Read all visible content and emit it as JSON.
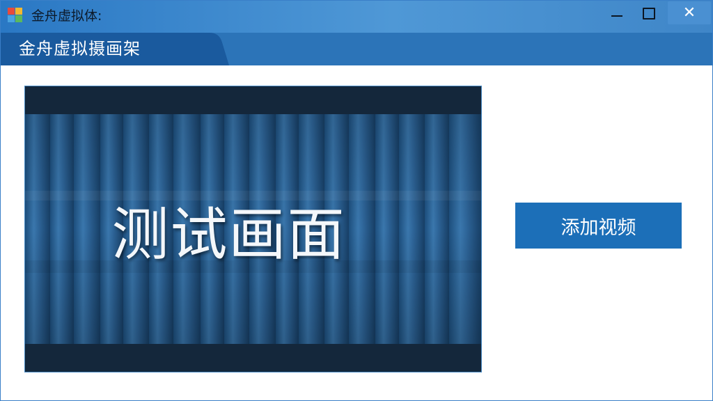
{
  "window": {
    "title": "金舟虚拟体:",
    "icon": "app-logo-icon",
    "controls": {
      "minimize_icon": "minimize-icon",
      "maximize_icon": "maximize-icon",
      "close_icon": "close-icon",
      "close_glyph": "✕"
    }
  },
  "header": {
    "title": "金舟虚拟摄画架"
  },
  "preview": {
    "overlay_text": "测试画面"
  },
  "actions": {
    "add_video_label": "添加视频"
  },
  "colors": {
    "titlebar": "#3f86c8",
    "header": "#2c74b8",
    "header_tab": "#1a5a9e",
    "button": "#1c6fb8",
    "preview_bg": "#1e3f60"
  }
}
